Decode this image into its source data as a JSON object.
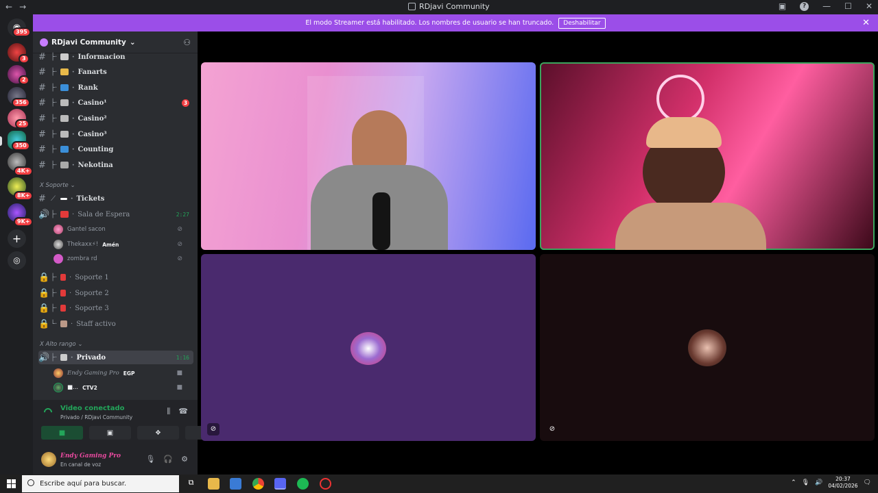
{
  "window": {
    "title": "RDjavi Community",
    "back": "←",
    "forward": "→"
  },
  "rail": {
    "badges": [
      "395",
      "3",
      "2",
      "356",
      "25",
      "350",
      "4K+",
      "8K+",
      "9K+"
    ]
  },
  "banner": {
    "text": "El modo Streamer está habilitado. Los nombres de usuario se han truncado.",
    "button": "Deshabilitar"
  },
  "server": {
    "name": "RDjavi Community"
  },
  "channels": [
    {
      "name": "Informacion",
      "type": "text"
    },
    {
      "name": "Fanarts",
      "type": "text"
    },
    {
      "name": "Rank",
      "type": "text"
    },
    {
      "name": "Casino¹",
      "type": "text",
      "count": "3"
    },
    {
      "name": "Casino²",
      "type": "text"
    },
    {
      "name": "Casino³",
      "type": "text"
    },
    {
      "name": "Counting",
      "type": "text"
    },
    {
      "name": "Nekotina",
      "type": "text"
    }
  ],
  "categories": {
    "soporte": "Soporte",
    "alto_rango": "Alto rango"
  },
  "soporte": {
    "tickets": "Tickets",
    "sala": "Sala de Espera",
    "sala_time": "2:27",
    "members": [
      {
        "name": "Gantel sacon"
      },
      {
        "name": "Thekaxx⚡!",
        "tag": "Amén"
      },
      {
        "name": "zombra rd"
      }
    ],
    "locked": [
      "Soporte 1",
      "Soporte 2",
      "Soporte 3",
      "Staff activo"
    ]
  },
  "alto_rango": {
    "privado": "Privado",
    "privado_time": "1:16",
    "members": [
      {
        "name": "Endy Gaming Pro",
        "tag": "EGP"
      },
      {
        "name": "■...",
        "tag": "CTV2"
      }
    ]
  },
  "voice": {
    "status": "Video conectado",
    "channel": "Privado / RDjavi Community"
  },
  "user": {
    "name": "Endy Gaming Pro",
    "status": "En canal de voz"
  },
  "taskbar": {
    "search_placeholder": "Escribe aquí para buscar.",
    "time": "20:37",
    "date": "04/02/2026"
  },
  "colors": {
    "accent_banner": "#9b4ee8",
    "speaking": "#3ba55d",
    "voice_connected": "#23a55a",
    "badge": "#f23f43"
  }
}
